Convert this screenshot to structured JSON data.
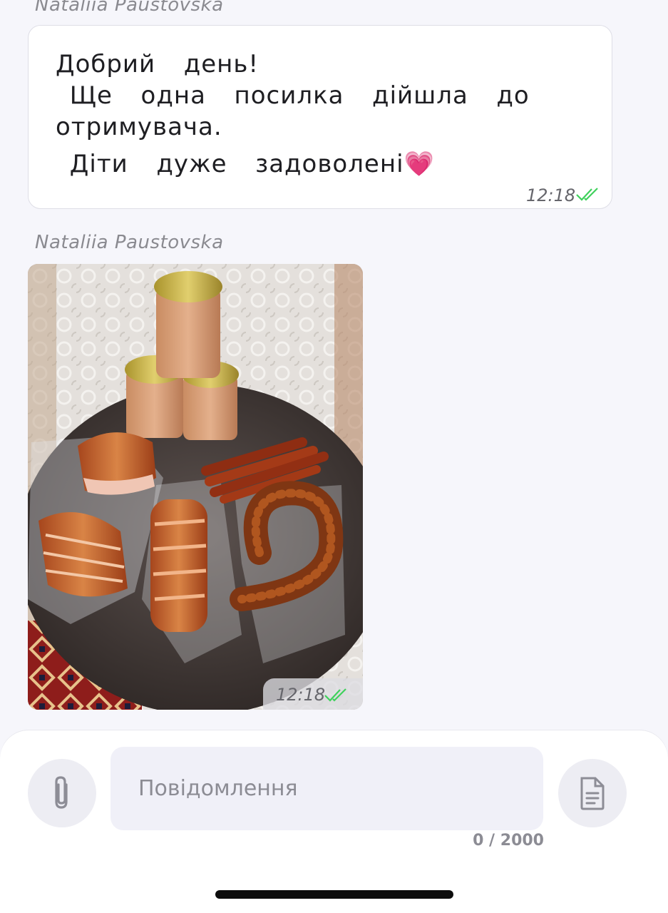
{
  "messages": [
    {
      "sender": "Nataliia Paustovska",
      "lines": [
        "Добрий  день!",
        " Ще  одна  посилка  дійшла  до",
        "отримувача.",
        " Діти  дуже  задоволені💗"
      ],
      "time": "12:18",
      "status_icon": "double-check-icon"
    },
    {
      "sender": "Nataliia Paustovska",
      "type": "photo",
      "time": "12:18",
      "status_icon": "double-check-icon"
    }
  ],
  "composer": {
    "placeholder": "Повідомлення",
    "value": "",
    "counter": "0 / 2000",
    "attach_icon": "paperclip-icon",
    "template_icon": "document-icon"
  },
  "colors": {
    "check": "#3fd15c",
    "background": "#f6f6fb",
    "input_bg": "#f0f0f8"
  }
}
